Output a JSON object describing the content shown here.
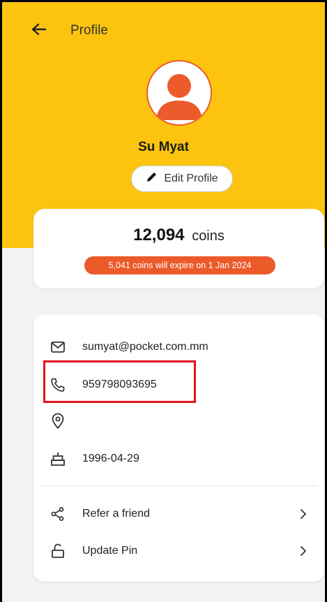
{
  "header": {
    "title": "Profile",
    "back_icon": "arrow-left-icon"
  },
  "profile": {
    "name": "Su Myat",
    "avatar_icon": "user-avatar-icon",
    "edit_label": "Edit Profile",
    "edit_icon": "pencil-icon"
  },
  "coins": {
    "amount": "12,094",
    "unit": "coins",
    "expire_notice": "5,041 coins will expire on 1 Jan 2024"
  },
  "details": {
    "email": "sumyat@pocket.com.mm",
    "phone": "959798093695",
    "address": "",
    "birthday": "1996-04-29"
  },
  "actions": {
    "refer_label": "Refer a friend",
    "update_pin_label": "Update Pin"
  },
  "colors": {
    "header_bg": "#fcc40f",
    "accent": "#ec5a2a",
    "highlight": "#e3151b"
  }
}
